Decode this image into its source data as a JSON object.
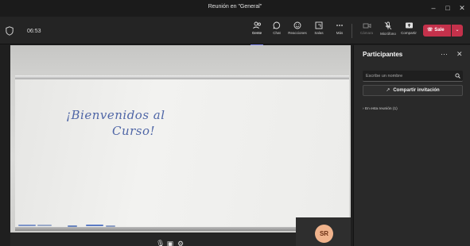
{
  "window": {
    "title": "Reunión en \"General\""
  },
  "meeting": {
    "timer": "06:53"
  },
  "toolbar": {
    "gente": "Gente",
    "chat": "Chat",
    "reacciones": "Reacciones",
    "salas": "Salas",
    "mas": "Más",
    "camara": "Cámara",
    "microfono": "Micrófono",
    "compartir": "Compartir",
    "sale": "Sale"
  },
  "stage": {
    "whiteboard_line1": "¡Bienvenidos al",
    "whiteboard_line2": "Curso!"
  },
  "self_tile": {
    "initials": "SR"
  },
  "participants_panel": {
    "title": "Participantes",
    "search_placeholder": "Escribe un nombre",
    "invite_label": "Compartir invitación",
    "section_label": "En esta reunión (1)"
  },
  "colors": {
    "accent": "#7b83eb",
    "leave": "#c4314b",
    "avatar_bg": "#f0b38c",
    "ink": "#4f66a6"
  }
}
